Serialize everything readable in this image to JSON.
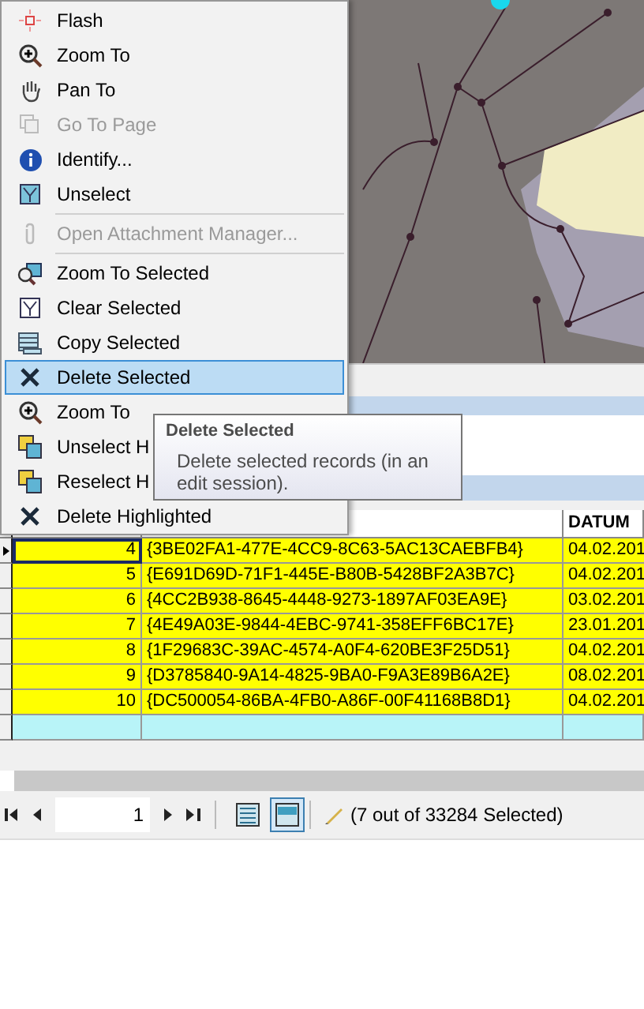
{
  "context_menu": {
    "items": [
      {
        "label": "Flash",
        "disabled": false,
        "selected": false,
        "separator_before": false
      },
      {
        "label": "Zoom To",
        "disabled": false,
        "selected": false,
        "separator_before": false
      },
      {
        "label": "Pan To",
        "disabled": false,
        "selected": false,
        "separator_before": false
      },
      {
        "label": "Go To Page",
        "disabled": true,
        "selected": false,
        "separator_before": false
      },
      {
        "label": "Identify...",
        "disabled": false,
        "selected": false,
        "separator_before": false
      },
      {
        "label": "Unselect",
        "disabled": false,
        "selected": false,
        "separator_before": false
      },
      {
        "label": "Open Attachment Manager...",
        "disabled": true,
        "selected": false,
        "separator_before": true
      },
      {
        "label": "Zoom To Selected",
        "disabled": false,
        "selected": false,
        "separator_before": true
      },
      {
        "label": "Clear Selected",
        "disabled": false,
        "selected": false,
        "separator_before": false
      },
      {
        "label": "Copy Selected",
        "disabled": false,
        "selected": false,
        "separator_before": false
      },
      {
        "label": "Delete Selected",
        "disabled": false,
        "selected": true,
        "separator_before": false
      },
      {
        "label": "Zoom To",
        "disabled": false,
        "selected": false,
        "separator_before": false
      },
      {
        "label": "Unselect H",
        "disabled": false,
        "selected": false,
        "separator_before": false
      },
      {
        "label": "Reselect H",
        "disabled": false,
        "selected": false,
        "separator_before": false
      },
      {
        "label": "Delete Highlighted",
        "disabled": false,
        "selected": false,
        "separator_before": false
      }
    ]
  },
  "tooltip": {
    "title": "Delete Selected",
    "text": "Delete selected records (in an edit session)."
  },
  "table": {
    "header": {
      "column_3": "DATUM"
    },
    "rows": [
      {
        "number": "4",
        "guid": "{3BE02FA1-477E-4CC9-8C63-5AC13CAEBFB4}",
        "date": "04.02.201",
        "selected": true,
        "current": true
      },
      {
        "number": "5",
        "guid": "{E691D69D-71F1-445E-B80B-5428BF2A3B7C}",
        "date": "04.02.201",
        "selected": true,
        "current": false
      },
      {
        "number": "6",
        "guid": "{4CC2B938-8645-4448-9273-1897AF03EA9E}",
        "date": "03.02.201",
        "selected": true,
        "current": false
      },
      {
        "number": "7",
        "guid": "{4E49A03E-9844-4EBC-9741-358EFF6BC17E}",
        "date": "23.01.201",
        "selected": true,
        "current": false
      },
      {
        "number": "8",
        "guid": "{1F29683C-39AC-4574-A0F4-620BE3F25D51}",
        "date": "04.02.201",
        "selected": true,
        "current": false
      },
      {
        "number": "9",
        "guid": "{D3785840-9A14-4825-9BA0-F9A3E89B6A2E}",
        "date": "08.02.201",
        "selected": true,
        "current": false
      },
      {
        "number": "10",
        "guid": "{DC500054-86BA-4FB0-A86F-00F41168B8D1}",
        "date": "04.02.201",
        "selected": true,
        "current": false
      }
    ]
  },
  "navigator": {
    "page": "1",
    "views": [
      {
        "selected": false
      },
      {
        "selected": true
      }
    ],
    "status": "(7 out of 33284 Selected)"
  }
}
